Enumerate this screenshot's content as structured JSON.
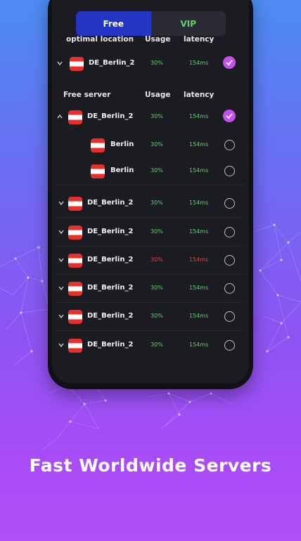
{
  "tabs": {
    "free": "Free",
    "vip": "VIP"
  },
  "optimal": {
    "header": "optimal location",
    "usage_header": "Usage",
    "latency_header": "latency",
    "server": {
      "name": "DE_Berlin_2",
      "usage": "30%",
      "latency": "154ms",
      "selected": true
    }
  },
  "free": {
    "header": "Free server",
    "usage_header": "Usage",
    "latency_header": "latency"
  },
  "servers": [
    {
      "name": "DE_Berlin_2",
      "usage": "30%",
      "latency": "154ms",
      "expanded": true,
      "selected": true
    },
    {
      "name": "Berlin",
      "usage": "30%",
      "latency": "154ms",
      "sub": true
    },
    {
      "name": "Berlin",
      "usage": "30%",
      "latency": "154ms",
      "sub": true
    },
    {
      "name": "DE_Berlin_2",
      "usage": "30%",
      "latency": "154ms"
    },
    {
      "name": "DE_Berlin_2",
      "usage": "30%",
      "latency": "154ms"
    },
    {
      "name": "DE_Berlin_2",
      "usage": "30%",
      "latency": "154ms",
      "status": "high"
    },
    {
      "name": "DE_Berlin_2",
      "usage": "30%",
      "latency": "154ms"
    },
    {
      "name": "DE_Berlin_2",
      "usage": "30%",
      "latency": "154ms"
    },
    {
      "name": "DE_Berlin_2",
      "usage": "30%",
      "latency": "154ms"
    }
  ],
  "tagline": "Fast Worldwide Servers",
  "colors": {
    "accent": "#2435c6",
    "good": "#5ed36d",
    "bad": "#e0433a",
    "check": "#c74ef0"
  }
}
